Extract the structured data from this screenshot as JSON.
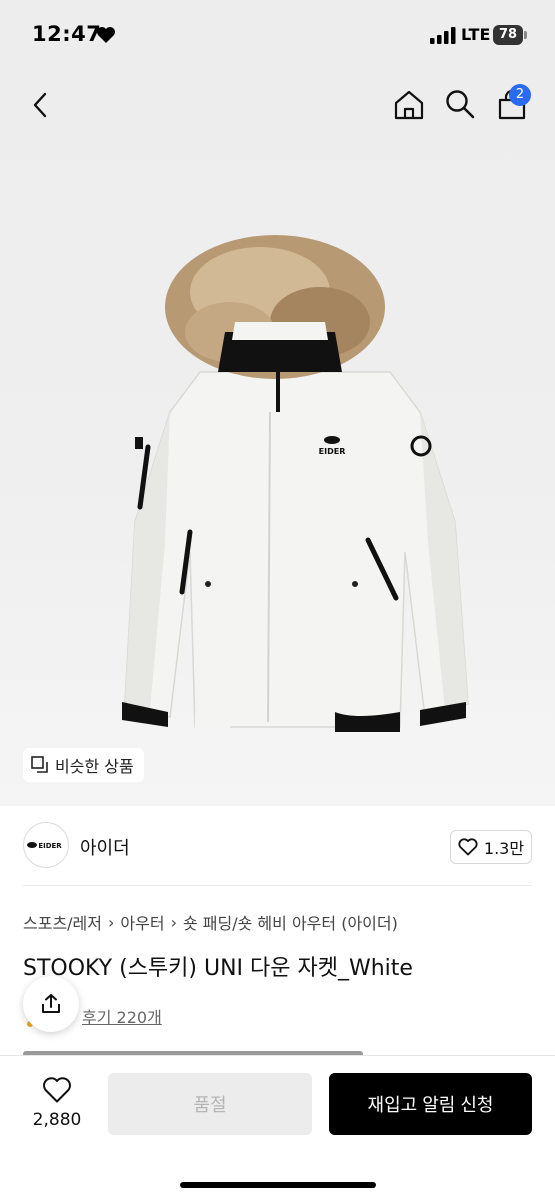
{
  "status_bar": {
    "time": "12:47",
    "heart_icon": "heart-filled-icon",
    "network": "LTE",
    "battery": "78"
  },
  "nav": {
    "back_icon": "chevron-left-icon",
    "home_icon": "home-icon",
    "search_icon": "search-icon",
    "cart_icon": "shopping-bag-icon",
    "cart_count": "2",
    "badge_color": "#2a6bf2"
  },
  "image": {
    "similar_label": "비슷한 상품",
    "similar_icon": "stacked-squares-icon",
    "jacket_logo_text": "EIDER"
  },
  "brand": {
    "logo_text": "EIDER",
    "name": "아이더",
    "like_icon": "heart-outline-icon",
    "like_count": "1.3만"
  },
  "breadcrumb": [
    "스포츠/레저",
    "아우터",
    "숏 패딩/숏 헤비 아우터 (아이더)"
  ],
  "product": {
    "title": "STOOKY (스투키) UNI 다운 자켓_White",
    "review_link": "후기 220개",
    "share_icon": "share-icon"
  },
  "action_bar": {
    "wish_icon": "heart-outline-icon",
    "wish_count": "2,880",
    "soldout_label": "품절",
    "restock_label": "재입고 알림 신청",
    "primary_color": "#000000"
  }
}
